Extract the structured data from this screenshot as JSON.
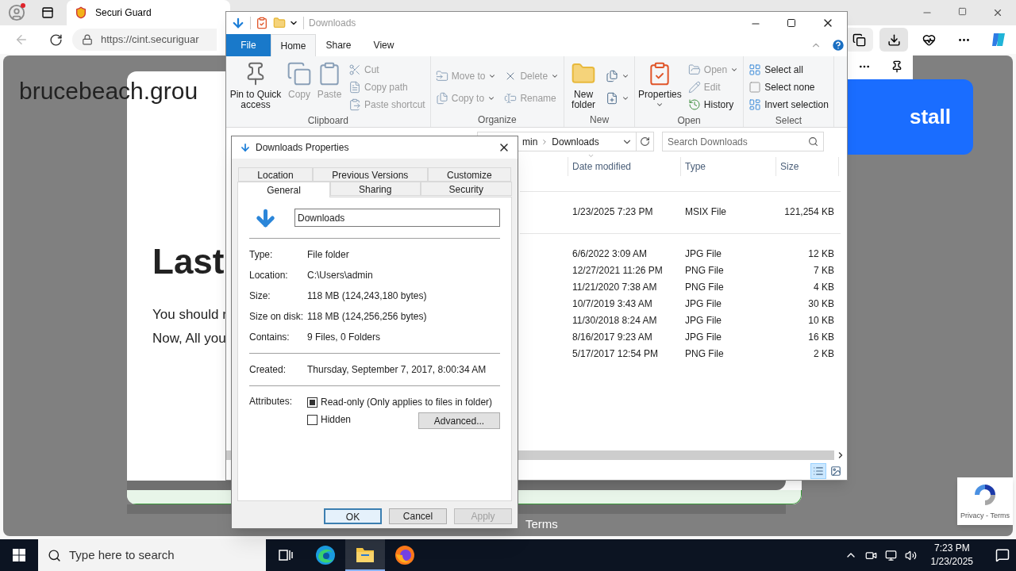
{
  "browser": {
    "tab_title": "Securi Guard",
    "url": "https://cint.securiguar",
    "page": {
      "site": "brucebeach.grou",
      "heading": "Last",
      "lines": [
        "You should r",
        "Now, All you"
      ],
      "footer_link": "Terms",
      "install_button": "stall",
      "recaptcha": "Privacy - Terms"
    }
  },
  "explorer": {
    "title": "Downloads",
    "ribbon_tabs": [
      {
        "label": "File",
        "kind": "file",
        "selected": false
      },
      {
        "label": "Home",
        "kind": "tab",
        "selected": true
      },
      {
        "label": "Share",
        "kind": "tab",
        "selected": false
      },
      {
        "label": "View",
        "kind": "tab",
        "selected": false
      }
    ],
    "ribbon_groups": [
      {
        "label": "Clipboard",
        "items": [
          {
            "kind": "large",
            "label": "Pin to Quick access",
            "disabled": false,
            "dropdown": false
          },
          {
            "kind": "large",
            "label": "Copy",
            "disabled": true,
            "dropdown": false
          },
          {
            "kind": "large",
            "label": "Paste",
            "disabled": true,
            "dropdown": false
          },
          {
            "kind": "column",
            "items": [
              {
                "label": "Cut",
                "disabled": true,
                "dropdown": false
              },
              {
                "label": "Copy path",
                "disabled": true,
                "dropdown": false
              },
              {
                "label": "Paste shortcut",
                "disabled": true,
                "dropdown": false
              }
            ]
          }
        ]
      },
      {
        "label": "Organize",
        "items": [
          {
            "kind": "column",
            "items": [
              {
                "label": "Move to",
                "disabled": true,
                "dropdown": true
              },
              {
                "label": "Copy to",
                "disabled": true,
                "dropdown": true
              }
            ]
          },
          {
            "kind": "column",
            "items": [
              {
                "label": "Delete",
                "disabled": true,
                "dropdown": true
              },
              {
                "label": "Rename",
                "disabled": true,
                "dropdown": false
              }
            ]
          }
        ]
      },
      {
        "label": "New",
        "items": [
          {
            "kind": "large",
            "label": "New folder",
            "disabled": false,
            "dropdown": false
          },
          {
            "kind": "column",
            "items": [
              {
                "disabled": false,
                "dropdown": true
              },
              {
                "disabled": false,
                "dropdown": true
              }
            ]
          }
        ]
      },
      {
        "label": "Open",
        "items": [
          {
            "kind": "large",
            "label": "Properties",
            "disabled": false,
            "dropdown": true
          },
          {
            "kind": "column",
            "items": [
              {
                "label": "Open",
                "disabled": true,
                "dropdown": true
              },
              {
                "label": "Edit",
                "disabled": true,
                "dropdown": false
              },
              {
                "label": "History",
                "disabled": false,
                "dropdown": false
              }
            ]
          }
        ]
      },
      {
        "label": "Select",
        "items": [
          {
            "kind": "column",
            "items": [
              {
                "label": "Select all",
                "disabled": false,
                "dropdown": false
              },
              {
                "label": "Select none",
                "disabled": false,
                "dropdown": false
              },
              {
                "label": "Invert selection",
                "disabled": false,
                "dropdown": false
              }
            ]
          }
        ]
      }
    ],
    "address": [
      "min",
      "Downloads"
    ],
    "search_placeholder": "Search Downloads",
    "columns": [
      "Date modified",
      "Type",
      "Size"
    ],
    "groups": [
      {
        "rows": [
          {
            "date": "1/23/2025 7:23 PM",
            "type": "MSIX File",
            "size": "121,254 KB"
          }
        ]
      },
      {
        "rows": [
          {
            "date": "6/6/2022 3:09 AM",
            "type": "JPG File",
            "size": "12 KB"
          },
          {
            "date": "12/27/2021 11:26 PM",
            "type": "PNG File",
            "size": "7 KB"
          },
          {
            "date": "11/21/2020 7:38 AM",
            "type": "PNG File",
            "size": "4 KB"
          },
          {
            "date": "10/7/2019 3:43 AM",
            "type": "JPG File",
            "size": "30 KB"
          },
          {
            "date": "11/30/2018 8:24 AM",
            "type": "JPG File",
            "size": "10 KB"
          },
          {
            "date": "8/16/2017 9:23 AM",
            "type": "JPG File",
            "size": "16 KB"
          },
          {
            "date": "5/17/2017 12:54 PM",
            "type": "PNG File",
            "size": "2 KB"
          }
        ]
      }
    ],
    "views": [
      {
        "kind": "details",
        "selected": true
      },
      {
        "kind": "large-icons",
        "selected": false
      }
    ]
  },
  "dialog": {
    "title": "Downloads Properties",
    "tab_rows": [
      {
        "tabs": [
          {
            "label": "Location",
            "selected": false
          },
          {
            "label": "Previous Versions",
            "selected": false
          },
          {
            "label": "Customize",
            "selected": false
          }
        ]
      },
      {
        "tabs": [
          {
            "label": "General",
            "selected": true
          },
          {
            "label": "Sharing",
            "selected": false
          },
          {
            "label": "Security",
            "selected": false
          }
        ]
      }
    ],
    "name": "Downloads",
    "sections": [
      {
        "fields": [
          {
            "label": "Type:",
            "value": "File folder"
          },
          {
            "label": "Location:",
            "value": "C:\\Users\\admin"
          },
          {
            "label": "Size:",
            "value": "118 MB (124,243,180 bytes)"
          },
          {
            "label": "Size on disk:",
            "value": "118 MB (124,256,256 bytes)"
          },
          {
            "label": "Contains:",
            "value": "9 Files, 0 Folders"
          }
        ]
      },
      {
        "fields": [
          {
            "label": "Created:",
            "value": "Thursday, September 7, 2017, 8:00:34 AM"
          }
        ]
      }
    ],
    "attributes_label": "Attributes:",
    "checkboxes": [
      {
        "label": "Read-only (Only applies to files in folder)",
        "checked": false,
        "indeterminate": true
      },
      {
        "label": "Hidden",
        "checked": false,
        "indeterminate": false
      }
    ],
    "advanced_button": "Advanced...",
    "buttons": [
      {
        "label": "OK",
        "default": true,
        "disabled": false
      },
      {
        "label": "Cancel",
        "default": false,
        "disabled": false
      },
      {
        "label": "Apply",
        "default": false,
        "disabled": true
      }
    ]
  },
  "taskbar": {
    "search_placeholder": "Type here to search",
    "apps": [
      {
        "kind": "task-view",
        "selected": false
      },
      {
        "kind": "edge",
        "selected": false
      },
      {
        "kind": "explorer",
        "selected": true
      },
      {
        "kind": "firefox",
        "selected": false
      }
    ],
    "time": "7:23 PM",
    "date": "1/23/2025"
  }
}
